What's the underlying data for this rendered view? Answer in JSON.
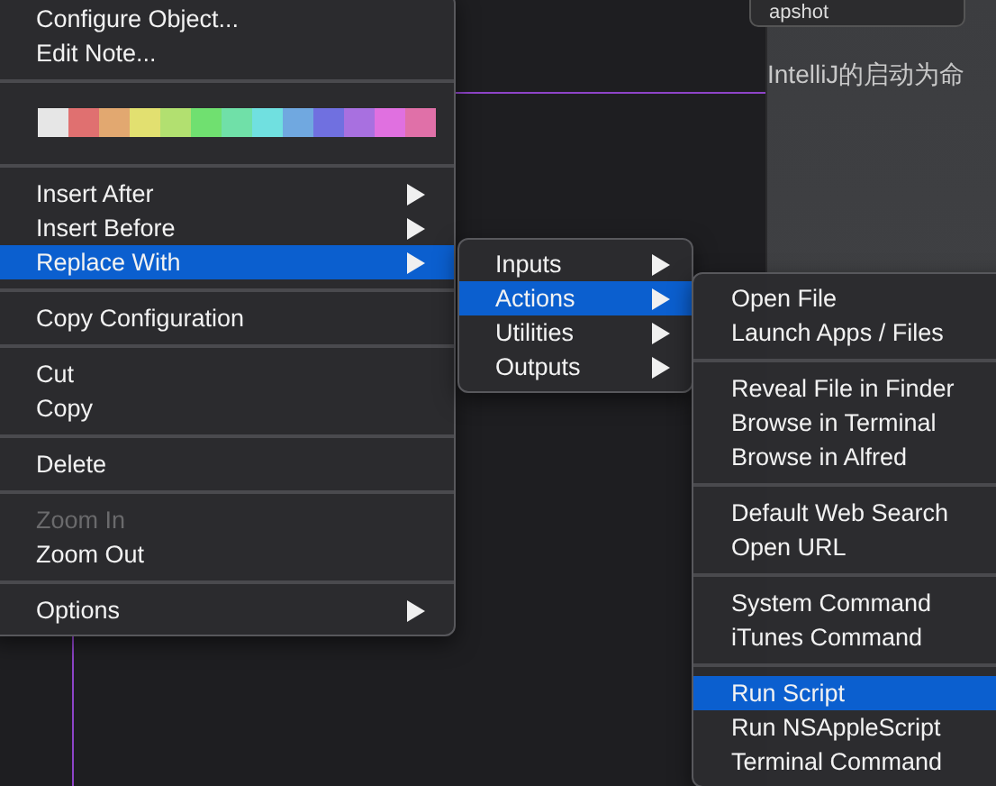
{
  "background": {
    "popup_text": "apshot",
    "note_text": "IntelliJ的启动为命"
  },
  "menus": [
    {
      "sections": [
        {
          "kind": "items",
          "items": [
            {
              "label": "Configure Object...",
              "submenu": false,
              "selected": false,
              "disabled": false
            },
            {
              "label": "Edit Note...",
              "submenu": false,
              "selected": false,
              "disabled": false
            }
          ]
        },
        {
          "kind": "colors",
          "colors": [
            {
              "color": "#e6e6e6"
            },
            {
              "color": "#e07070"
            },
            {
              "color": "#e2a870"
            },
            {
              "color": "#e2e070"
            },
            {
              "color": "#b2e070"
            },
            {
              "color": "#70e070"
            },
            {
              "color": "#70e0a8"
            },
            {
              "color": "#70e0e0"
            },
            {
              "color": "#70a8e0"
            },
            {
              "color": "#7070e0"
            },
            {
              "color": "#a870e0"
            },
            {
              "color": "#e070e0"
            },
            {
              "color": "#e070a8"
            }
          ]
        },
        {
          "kind": "items",
          "items": [
            {
              "label": "Insert After",
              "submenu": true,
              "selected": false,
              "disabled": false
            },
            {
              "label": "Insert Before",
              "submenu": true,
              "selected": false,
              "disabled": false
            },
            {
              "label": "Replace With",
              "submenu": true,
              "selected": true,
              "disabled": false
            }
          ]
        },
        {
          "kind": "items",
          "items": [
            {
              "label": "Copy Configuration",
              "submenu": false,
              "selected": false,
              "disabled": false
            }
          ]
        },
        {
          "kind": "items",
          "items": [
            {
              "label": "Cut",
              "submenu": false,
              "selected": false,
              "disabled": false
            },
            {
              "label": "Copy",
              "submenu": false,
              "selected": false,
              "disabled": false
            }
          ]
        },
        {
          "kind": "items",
          "items": [
            {
              "label": "Delete",
              "submenu": false,
              "selected": false,
              "disabled": false
            }
          ]
        },
        {
          "kind": "items",
          "items": [
            {
              "label": "Zoom In",
              "submenu": false,
              "selected": false,
              "disabled": true
            },
            {
              "label": "Zoom Out",
              "submenu": false,
              "selected": false,
              "disabled": false
            }
          ]
        },
        {
          "kind": "items",
          "items": [
            {
              "label": "Options",
              "submenu": true,
              "selected": false,
              "disabled": false
            }
          ]
        }
      ]
    },
    {
      "sections": [
        {
          "kind": "items",
          "items": [
            {
              "label": "Inputs",
              "submenu": true,
              "selected": false,
              "disabled": false
            },
            {
              "label": "Actions",
              "submenu": true,
              "selected": true,
              "disabled": false
            },
            {
              "label": "Utilities",
              "submenu": true,
              "selected": false,
              "disabled": false
            },
            {
              "label": "Outputs",
              "submenu": true,
              "selected": false,
              "disabled": false
            }
          ]
        }
      ]
    },
    {
      "sections": [
        {
          "kind": "items",
          "items": [
            {
              "label": "Open File",
              "submenu": false,
              "selected": false,
              "disabled": false
            },
            {
              "label": "Launch Apps / Files",
              "submenu": false,
              "selected": false,
              "disabled": false
            }
          ]
        },
        {
          "kind": "items",
          "items": [
            {
              "label": "Reveal File in Finder",
              "submenu": false,
              "selected": false,
              "disabled": false
            },
            {
              "label": "Browse in Terminal",
              "submenu": false,
              "selected": false,
              "disabled": false
            },
            {
              "label": "Browse in Alfred",
              "submenu": false,
              "selected": false,
              "disabled": false
            }
          ]
        },
        {
          "kind": "items",
          "items": [
            {
              "label": "Default Web Search",
              "submenu": false,
              "selected": false,
              "disabled": false
            },
            {
              "label": "Open URL",
              "submenu": false,
              "selected": false,
              "disabled": false
            }
          ]
        },
        {
          "kind": "items",
          "items": [
            {
              "label": "System Command",
              "submenu": false,
              "selected": false,
              "disabled": false
            },
            {
              "label": "iTunes Command",
              "submenu": false,
              "selected": false,
              "disabled": false
            }
          ]
        },
        {
          "kind": "items",
          "items": [
            {
              "label": "Run Script",
              "submenu": false,
              "selected": true,
              "disabled": false
            },
            {
              "label": "Run NSAppleScript",
              "submenu": false,
              "selected": false,
              "disabled": false
            },
            {
              "label": "Terminal Command",
              "submenu": false,
              "selected": false,
              "disabled": false
            }
          ]
        }
      ]
    }
  ]
}
